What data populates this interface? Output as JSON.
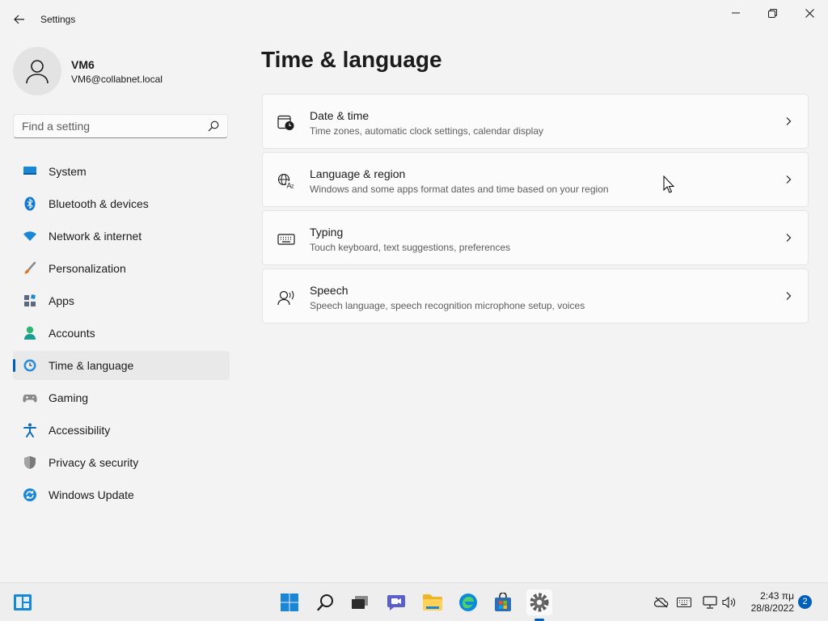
{
  "window": {
    "title": "Settings"
  },
  "profile": {
    "name": "VM6",
    "email": "VM6@collabnet.local"
  },
  "search": {
    "placeholder": "Find a setting"
  },
  "sidebar": {
    "items": [
      {
        "label": "System",
        "icon": "system-icon"
      },
      {
        "label": "Bluetooth & devices",
        "icon": "bluetooth-icon"
      },
      {
        "label": "Network & internet",
        "icon": "network-icon"
      },
      {
        "label": "Personalization",
        "icon": "brush-icon"
      },
      {
        "label": "Apps",
        "icon": "apps-icon"
      },
      {
        "label": "Accounts",
        "icon": "accounts-icon"
      },
      {
        "label": "Time & language",
        "icon": "time-language-icon",
        "active": true
      },
      {
        "label": "Gaming",
        "icon": "gamepad-icon"
      },
      {
        "label": "Accessibility",
        "icon": "accessibility-icon"
      },
      {
        "label": "Privacy & security",
        "icon": "shield-icon"
      },
      {
        "label": "Windows Update",
        "icon": "update-icon"
      }
    ]
  },
  "main": {
    "title": "Time & language",
    "cards": [
      {
        "title": "Date & time",
        "subtitle": "Time zones, automatic clock settings, calendar display",
        "icon": "calendar-clock-icon"
      },
      {
        "title": "Language & region",
        "subtitle": "Windows and some apps format dates and time based on your region",
        "icon": "language-icon"
      },
      {
        "title": "Typing",
        "subtitle": "Touch keyboard, text suggestions, preferences",
        "icon": "keyboard-icon"
      },
      {
        "title": "Speech",
        "subtitle": "Speech language, speech recognition microphone setup, voices",
        "icon": "speech-icon"
      }
    ]
  },
  "taskbar": {
    "time": "2:43 πμ",
    "date": "28/8/2022",
    "notification_count": "2"
  },
  "colors": {
    "accent": "#005fb8",
    "background": "#f3f3f3",
    "card": "#fbfbfb"
  }
}
